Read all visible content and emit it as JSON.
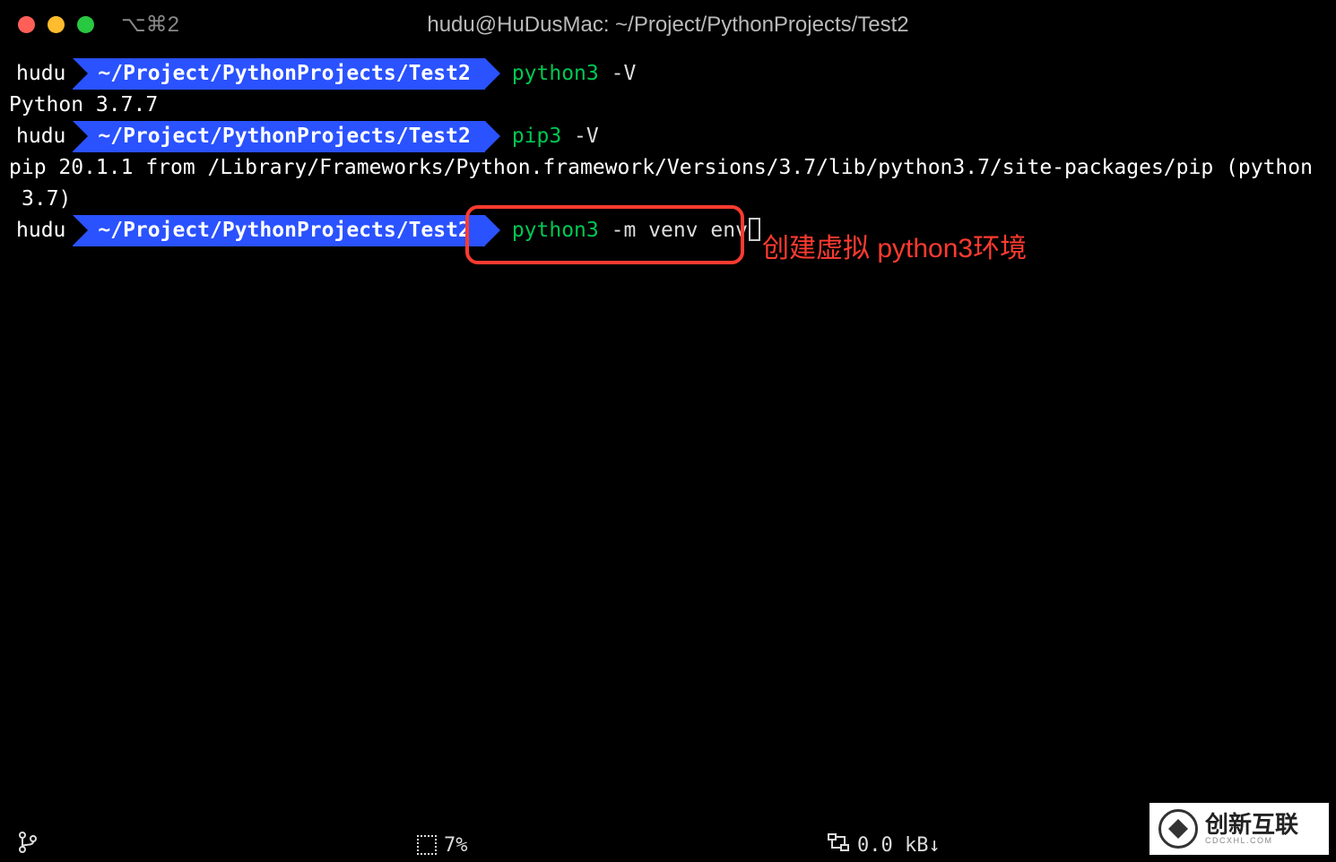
{
  "window": {
    "shortcut": "⌥⌘2",
    "title": "hudu@HuDusMac: ~/Project/PythonProjects/Test2"
  },
  "prompt": {
    "user": "hudu",
    "path": "~/Project/PythonProjects/Test2"
  },
  "lines": {
    "l1": {
      "exe": "python3",
      "arg": " -V"
    },
    "l1_out": "Python 3.7.7",
    "l2": {
      "exe": "pip3",
      "arg": " -V"
    },
    "l2_out1": "pip 20.1.1 from /Library/Frameworks/Python.framework/Versions/3.7/lib/python3.7/site-packages/pip (python",
    "l2_out2": "3.7)",
    "l3": {
      "exe": "python3",
      "arg": " -m venv env"
    }
  },
  "annotation": "创建虚拟 python3环境",
  "status": {
    "cpu": "7%",
    "net": "0.0 kB↓"
  },
  "watermark": {
    "cn": "创新互联",
    "en": "CDCXHL.COM"
  }
}
